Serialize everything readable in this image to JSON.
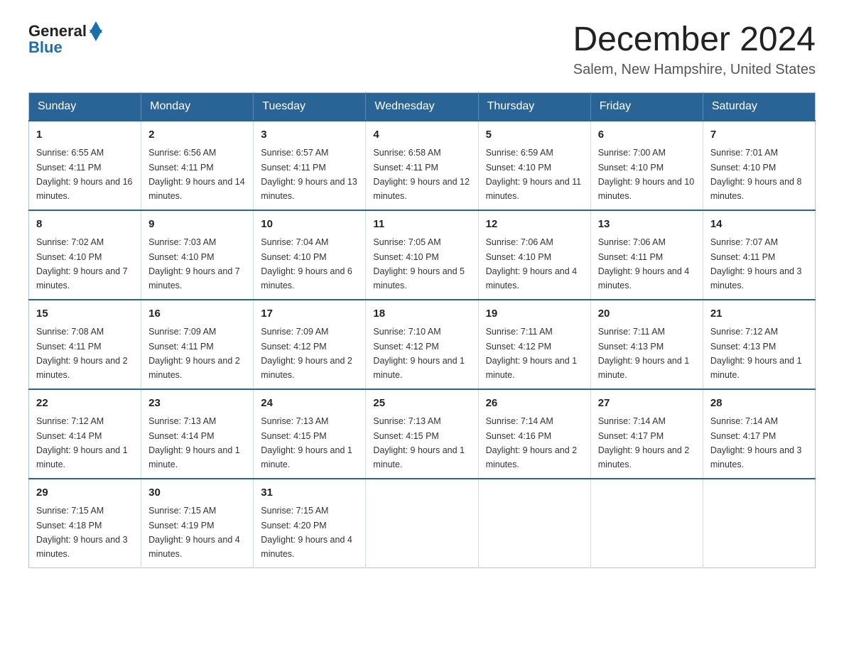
{
  "logo": {
    "general": "General",
    "blue": "Blue"
  },
  "header": {
    "title": "December 2024",
    "subtitle": "Salem, New Hampshire, United States"
  },
  "weekdays": [
    "Sunday",
    "Monday",
    "Tuesday",
    "Wednesday",
    "Thursday",
    "Friday",
    "Saturday"
  ],
  "weeks": [
    [
      {
        "day": "1",
        "sunrise": "6:55 AM",
        "sunset": "4:11 PM",
        "daylight": "9 hours and 16 minutes."
      },
      {
        "day": "2",
        "sunrise": "6:56 AM",
        "sunset": "4:11 PM",
        "daylight": "9 hours and 14 minutes."
      },
      {
        "day": "3",
        "sunrise": "6:57 AM",
        "sunset": "4:11 PM",
        "daylight": "9 hours and 13 minutes."
      },
      {
        "day": "4",
        "sunrise": "6:58 AM",
        "sunset": "4:11 PM",
        "daylight": "9 hours and 12 minutes."
      },
      {
        "day": "5",
        "sunrise": "6:59 AM",
        "sunset": "4:10 PM",
        "daylight": "9 hours and 11 minutes."
      },
      {
        "day": "6",
        "sunrise": "7:00 AM",
        "sunset": "4:10 PM",
        "daylight": "9 hours and 10 minutes."
      },
      {
        "day": "7",
        "sunrise": "7:01 AM",
        "sunset": "4:10 PM",
        "daylight": "9 hours and 8 minutes."
      }
    ],
    [
      {
        "day": "8",
        "sunrise": "7:02 AM",
        "sunset": "4:10 PM",
        "daylight": "9 hours and 7 minutes."
      },
      {
        "day": "9",
        "sunrise": "7:03 AM",
        "sunset": "4:10 PM",
        "daylight": "9 hours and 7 minutes."
      },
      {
        "day": "10",
        "sunrise": "7:04 AM",
        "sunset": "4:10 PM",
        "daylight": "9 hours and 6 minutes."
      },
      {
        "day": "11",
        "sunrise": "7:05 AM",
        "sunset": "4:10 PM",
        "daylight": "9 hours and 5 minutes."
      },
      {
        "day": "12",
        "sunrise": "7:06 AM",
        "sunset": "4:10 PM",
        "daylight": "9 hours and 4 minutes."
      },
      {
        "day": "13",
        "sunrise": "7:06 AM",
        "sunset": "4:11 PM",
        "daylight": "9 hours and 4 minutes."
      },
      {
        "day": "14",
        "sunrise": "7:07 AM",
        "sunset": "4:11 PM",
        "daylight": "9 hours and 3 minutes."
      }
    ],
    [
      {
        "day": "15",
        "sunrise": "7:08 AM",
        "sunset": "4:11 PM",
        "daylight": "9 hours and 2 minutes."
      },
      {
        "day": "16",
        "sunrise": "7:09 AM",
        "sunset": "4:11 PM",
        "daylight": "9 hours and 2 minutes."
      },
      {
        "day": "17",
        "sunrise": "7:09 AM",
        "sunset": "4:12 PM",
        "daylight": "9 hours and 2 minutes."
      },
      {
        "day": "18",
        "sunrise": "7:10 AM",
        "sunset": "4:12 PM",
        "daylight": "9 hours and 1 minute."
      },
      {
        "day": "19",
        "sunrise": "7:11 AM",
        "sunset": "4:12 PM",
        "daylight": "9 hours and 1 minute."
      },
      {
        "day": "20",
        "sunrise": "7:11 AM",
        "sunset": "4:13 PM",
        "daylight": "9 hours and 1 minute."
      },
      {
        "day": "21",
        "sunrise": "7:12 AM",
        "sunset": "4:13 PM",
        "daylight": "9 hours and 1 minute."
      }
    ],
    [
      {
        "day": "22",
        "sunrise": "7:12 AM",
        "sunset": "4:14 PM",
        "daylight": "9 hours and 1 minute."
      },
      {
        "day": "23",
        "sunrise": "7:13 AM",
        "sunset": "4:14 PM",
        "daylight": "9 hours and 1 minute."
      },
      {
        "day": "24",
        "sunrise": "7:13 AM",
        "sunset": "4:15 PM",
        "daylight": "9 hours and 1 minute."
      },
      {
        "day": "25",
        "sunrise": "7:13 AM",
        "sunset": "4:15 PM",
        "daylight": "9 hours and 1 minute."
      },
      {
        "day": "26",
        "sunrise": "7:14 AM",
        "sunset": "4:16 PM",
        "daylight": "9 hours and 2 minutes."
      },
      {
        "day": "27",
        "sunrise": "7:14 AM",
        "sunset": "4:17 PM",
        "daylight": "9 hours and 2 minutes."
      },
      {
        "day": "28",
        "sunrise": "7:14 AM",
        "sunset": "4:17 PM",
        "daylight": "9 hours and 3 minutes."
      }
    ],
    [
      {
        "day": "29",
        "sunrise": "7:15 AM",
        "sunset": "4:18 PM",
        "daylight": "9 hours and 3 minutes."
      },
      {
        "day": "30",
        "sunrise": "7:15 AM",
        "sunset": "4:19 PM",
        "daylight": "9 hours and 4 minutes."
      },
      {
        "day": "31",
        "sunrise": "7:15 AM",
        "sunset": "4:20 PM",
        "daylight": "9 hours and 4 minutes."
      },
      null,
      null,
      null,
      null
    ]
  ]
}
